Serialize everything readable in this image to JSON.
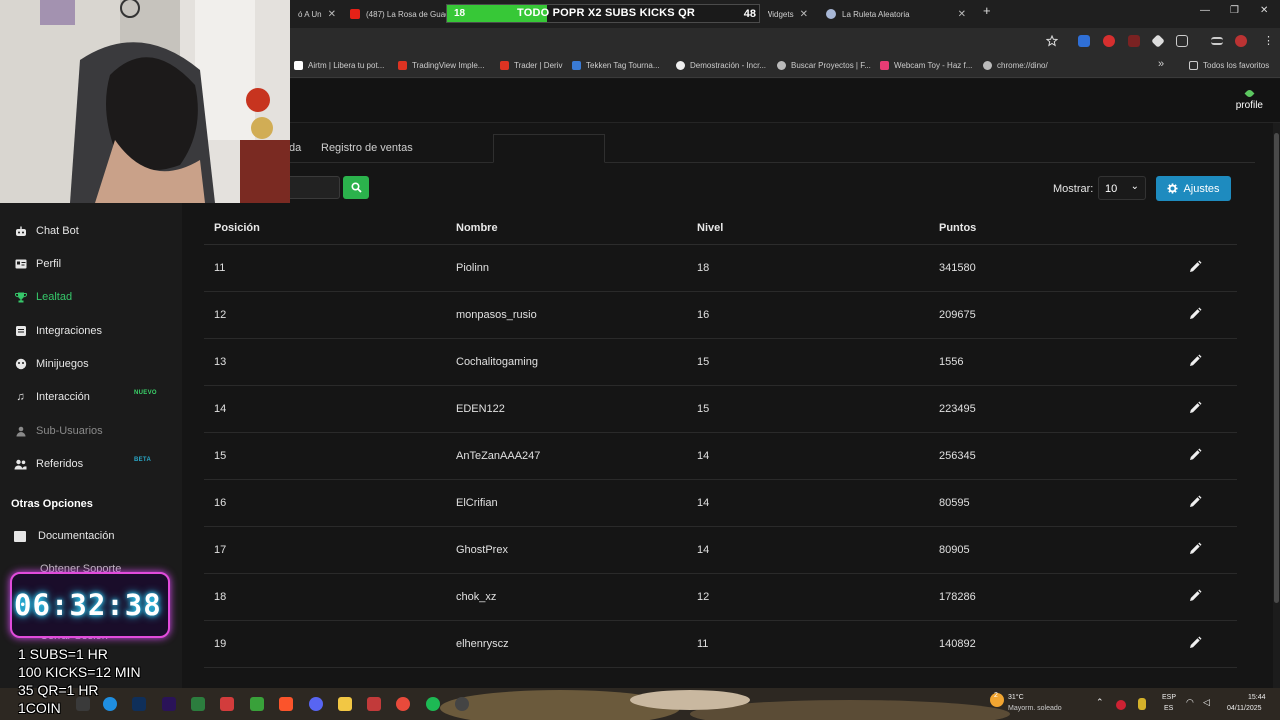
{
  "browser": {
    "tabs": [
      {
        "title": "ó A Un"
      },
      {
        "title": "(487) La Rosa de Guad"
      },
      {
        "title": "best ChatBot Widgets"
      },
      {
        "title": "La Ruleta Aleatoria"
      }
    ],
    "new_tab": "+",
    "window_controls": [
      "—",
      "❐",
      "✕"
    ],
    "bookmarks": [
      {
        "label": "Airtm | Libera tu pot..."
      },
      {
        "label": "TradingView Imple..."
      },
      {
        "label": "Trader | Deriv"
      },
      {
        "label": "Tekken Tag Tourna..."
      },
      {
        "label": "Demostración - Incr..."
      },
      {
        "label": "Buscar Proyectos | F..."
      },
      {
        "label": "Webcam Toy - Haz f..."
      },
      {
        "label": "chrome://dino/"
      }
    ],
    "bookmarks_overflow": "»",
    "all_favorites": "Todos los favoritos"
  },
  "stream_banner": {
    "left_number": "18",
    "text": "TODO POPR X2 SUBS KICKS QR",
    "right_number": "48",
    "fill_fraction": 0.32
  },
  "header": {
    "profile_label": "profile"
  },
  "sidebar": {
    "items": [
      {
        "label": "Chat Bot",
        "icon": "robot-icon"
      },
      {
        "label": "Perfil",
        "icon": "id-card-icon"
      },
      {
        "label": "Lealtad",
        "icon": "trophy-icon",
        "active": true
      },
      {
        "label": "Integraciones",
        "icon": "plug-icon"
      },
      {
        "label": "Minijuegos",
        "icon": "gamepad-icon"
      },
      {
        "label": "Interacción",
        "icon": "music-icon",
        "badge": "NUEVO"
      },
      {
        "label": "Sub-Usuarios",
        "icon": "users-icon",
        "disabled": true
      },
      {
        "label": "Referidos",
        "icon": "user-group-icon",
        "badge": "BETA"
      }
    ],
    "other_title": "Otras Opciones",
    "other_items": [
      {
        "label": "Documentación"
      },
      {
        "label": "Obtener Soporte"
      },
      {
        "label": "Cerrar Sesión"
      }
    ]
  },
  "main": {
    "tabs": [
      {
        "label": "da"
      },
      {
        "label": "Registro de ventas"
      }
    ],
    "mostrar_label": "Mostrar:",
    "page_size": "10",
    "settings_button": "Ajustes",
    "columns": [
      "Posición",
      "Nombre",
      "Nivel",
      "Puntos"
    ],
    "rows": [
      {
        "pos": "11",
        "name": "Piolinn",
        "level": "18",
        "points": "341580"
      },
      {
        "pos": "12",
        "name": "monpasos_rusio",
        "level": "16",
        "points": "209675"
      },
      {
        "pos": "13",
        "name": "Cochalitogaming",
        "level": "15",
        "points": "1556"
      },
      {
        "pos": "14",
        "name": "EDEN122",
        "level": "15",
        "points": "223495"
      },
      {
        "pos": "15",
        "name": "AnTeZanAAA247",
        "level": "14",
        "points": "256345"
      },
      {
        "pos": "16",
        "name": "ElCrifian",
        "level": "14",
        "points": "80595"
      },
      {
        "pos": "17",
        "name": "GhostPrex",
        "level": "14",
        "points": "80905"
      },
      {
        "pos": "18",
        "name": "chok_xz",
        "level": "12",
        "points": "178286"
      },
      {
        "pos": "19",
        "name": "elhenryscz",
        "level": "11",
        "points": "140892"
      }
    ]
  },
  "overlay": {
    "timer": "06:32:38",
    "lines": [
      "1 SUBS=1 HR",
      "100 KICKS=12 MIN",
      "35 QR=1 HR",
      "1COIN"
    ]
  },
  "taskbar": {
    "weather_temp": "31°C",
    "weather_desc": "Mayorm. soleado",
    "notification_count": "2",
    "lang_top": "ESP",
    "lang_bottom": "ES",
    "time": "15:44",
    "date": "04/11/2025"
  },
  "colors": {
    "accent_green": "#36c76a",
    "settings_blue": "#1e8bbf",
    "search_green": "#2bb24c"
  }
}
